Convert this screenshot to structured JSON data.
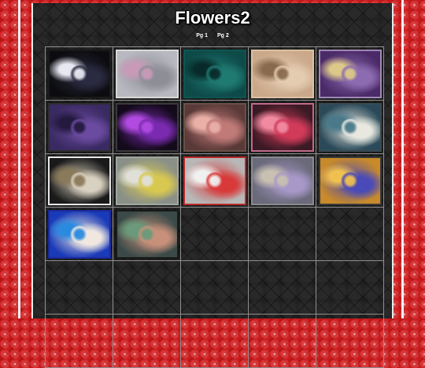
{
  "page": {
    "title": "Flowers2"
  },
  "pagination": [
    {
      "label": "Pg 1"
    },
    {
      "label": "Pg 2"
    }
  ],
  "thumbnails": [
    {
      "name": "thumb-white-lilies-dark",
      "colors": [
        "#0c0c10",
        "#2a2a40",
        "#e8e8f2"
      ],
      "frame": "#1a1a1a"
    },
    {
      "name": "thumb-pink-roses-silver",
      "colors": [
        "#b8b8c0",
        "#8e8e98",
        "#c89ab8"
      ],
      "frame": "#d8d8d8"
    },
    {
      "name": "thumb-teal-roses-face",
      "colors": [
        "#0d4a48",
        "#1f7a72",
        "#082a2a"
      ],
      "frame": "#0f5551"
    },
    {
      "name": "thumb-peach-flowers-beige",
      "colors": [
        "#caa88a",
        "#e4ccb0",
        "#8a6a4e"
      ],
      "frame": "#d9c2a3"
    },
    {
      "name": "thumb-purple-flowers-swirl",
      "colors": [
        "#4b2a68",
        "#8c6bb0",
        "#dcc888"
      ],
      "frame": "#a08ab8"
    },
    {
      "name": "thumb-purple-roses",
      "colors": [
        "#3a2a62",
        "#6a4ba0",
        "#241a40"
      ],
      "frame": "#2e2e2e"
    },
    {
      "name": "thumb-violet-flowers-black",
      "colors": [
        "#140a1c",
        "#7a2ab0",
        "#b04ae0"
      ],
      "frame": "#3a3a3a"
    },
    {
      "name": "thumb-pink-lilies-brown",
      "colors": [
        "#5a3a38",
        "#c07a78",
        "#eab0a8"
      ],
      "frame": "#6a5048"
    },
    {
      "name": "thumb-red-lilies-pink-frame",
      "colors": [
        "#3a1a24",
        "#d23a5a",
        "#f08aa0"
      ],
      "frame": "#c06a8a"
    },
    {
      "name": "thumb-daisies-teal",
      "colors": [
        "#2a4a5a",
        "#e8e8e0",
        "#4a7a8a"
      ],
      "frame": "#3a4a50"
    },
    {
      "name": "thumb-gold-flower-circle",
      "colors": [
        "#1a1a1a",
        "#d8d0c0",
        "#8a7a5a"
      ],
      "frame": "#e8e8e8"
    },
    {
      "name": "thumb-yellow-flowers-silver",
      "colors": [
        "#8a9088",
        "#d8c850",
        "#e0e0d8"
      ],
      "frame": "#a0a8a0"
    },
    {
      "name": "thumb-hand-red-rose",
      "colors": [
        "#b8b8b8",
        "#d83a3a",
        "#f0f0f0"
      ],
      "frame": "#b82a2a"
    },
    {
      "name": "thumb-lavender-abstract",
      "colors": [
        "#6a6a7a",
        "#a898c8",
        "#c8c0b0"
      ],
      "frame": "#8a8a90"
    },
    {
      "name": "thumb-blue-fractal-flowers",
      "colors": [
        "#c88a2a",
        "#4a4ab8",
        "#f0c050"
      ],
      "frame": "#3a3a3a"
    },
    {
      "name": "thumb-stained-glass-flowers",
      "colors": [
        "#1a3ab8",
        "#f0e8e0",
        "#2a8ae0"
      ],
      "frame": "#1a2a9a"
    },
    {
      "name": "thumb-circle-floral-plate",
      "colors": [
        "#3a4a48",
        "#c8907a",
        "#6a9a7a"
      ],
      "frame": "#1a1a1a"
    }
  ]
}
